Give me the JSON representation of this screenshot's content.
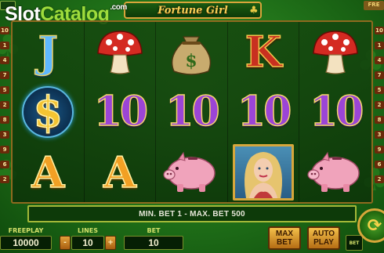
{
  "watermark": {
    "part1": "Slot",
    "part2": "Catalog",
    "part3": ".com"
  },
  "game": {
    "title": "Fortune Girl"
  },
  "top": {
    "right_tag": "FRE"
  },
  "paylines": {
    "left": [
      "10",
      "1",
      "4",
      "7",
      "5",
      "2",
      "8",
      "3",
      "9",
      "6",
      "2"
    ],
    "right": [
      "10",
      "1",
      "4",
      "7",
      "5",
      "2",
      "8",
      "3",
      "9",
      "6",
      "2"
    ]
  },
  "reels": [
    [
      "J",
      "$",
      "A"
    ],
    [
      "mushroom",
      "10",
      "A"
    ],
    [
      "money-bag",
      "10",
      "piggy-bank"
    ],
    [
      "K",
      "10",
      "girl"
    ],
    [
      "mushroom",
      "10",
      "piggy-bank"
    ]
  ],
  "symbols": {
    "ten": "10",
    "letter_J": "J",
    "letter_K": "K",
    "letter_A": "A",
    "dollar": "$"
  },
  "info": {
    "text": "MIN. BET 1 - MAX. BET 500"
  },
  "controls": {
    "freeplay": {
      "label": "FREEPLAY",
      "value": "10000"
    },
    "lines": {
      "label": "LINES",
      "value": "10",
      "minus": "-",
      "plus": "+"
    },
    "bet": {
      "label": "BET",
      "value": "10"
    },
    "max_bet": {
      "line1": "MAX",
      "line2": "BET"
    },
    "auto_play": {
      "line1": "AUTO",
      "line2": "PLAY"
    },
    "bet_small": "BET",
    "spin_icon": "spin-arrows-icon"
  },
  "colors": {
    "felt": "#1f6f18",
    "gold": "#d9a53a",
    "purple_ten": "#9b45d6"
  }
}
